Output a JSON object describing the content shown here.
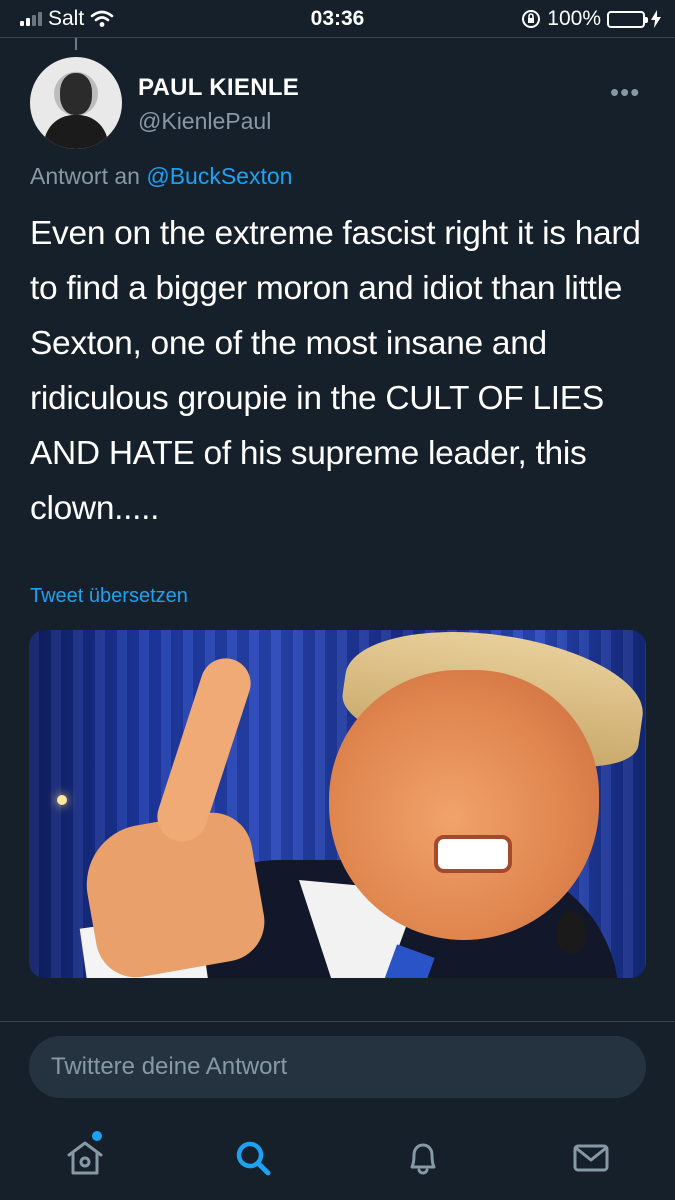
{
  "status_bar": {
    "carrier": "Salt",
    "time": "03:36",
    "battery_percent": "100%",
    "battery_level": 1.0
  },
  "tweet": {
    "author_name": "PAUL KIENLE",
    "author_handle": "@KienlePaul",
    "reply_prefix": "Antwort an",
    "reply_mention": "@BuckSexton",
    "text": "Even on the extreme fascist right it is hard to find a bigger moron and idiot than little Sexton, one of the most insane and ridiculous groupie in the CULT OF LIES AND HATE of his supreme leader, this clown.....",
    "translate_label": "Tweet übersetzen",
    "more_label": "•••"
  },
  "reply_box": {
    "placeholder": "Twittere deine Antwort",
    "value": ""
  },
  "tab_bar": {
    "items": [
      {
        "name": "home",
        "icon": "home-icon",
        "active": false
      },
      {
        "name": "search",
        "icon": "search-icon",
        "active": true
      },
      {
        "name": "notifications",
        "icon": "bell-icon",
        "active": false
      },
      {
        "name": "messages",
        "icon": "mail-icon",
        "active": false
      }
    ]
  },
  "colors": {
    "background": "#15202b",
    "accent": "#1da1f2",
    "muted_text": "#8899a6",
    "battery_green": "#4cd964"
  }
}
